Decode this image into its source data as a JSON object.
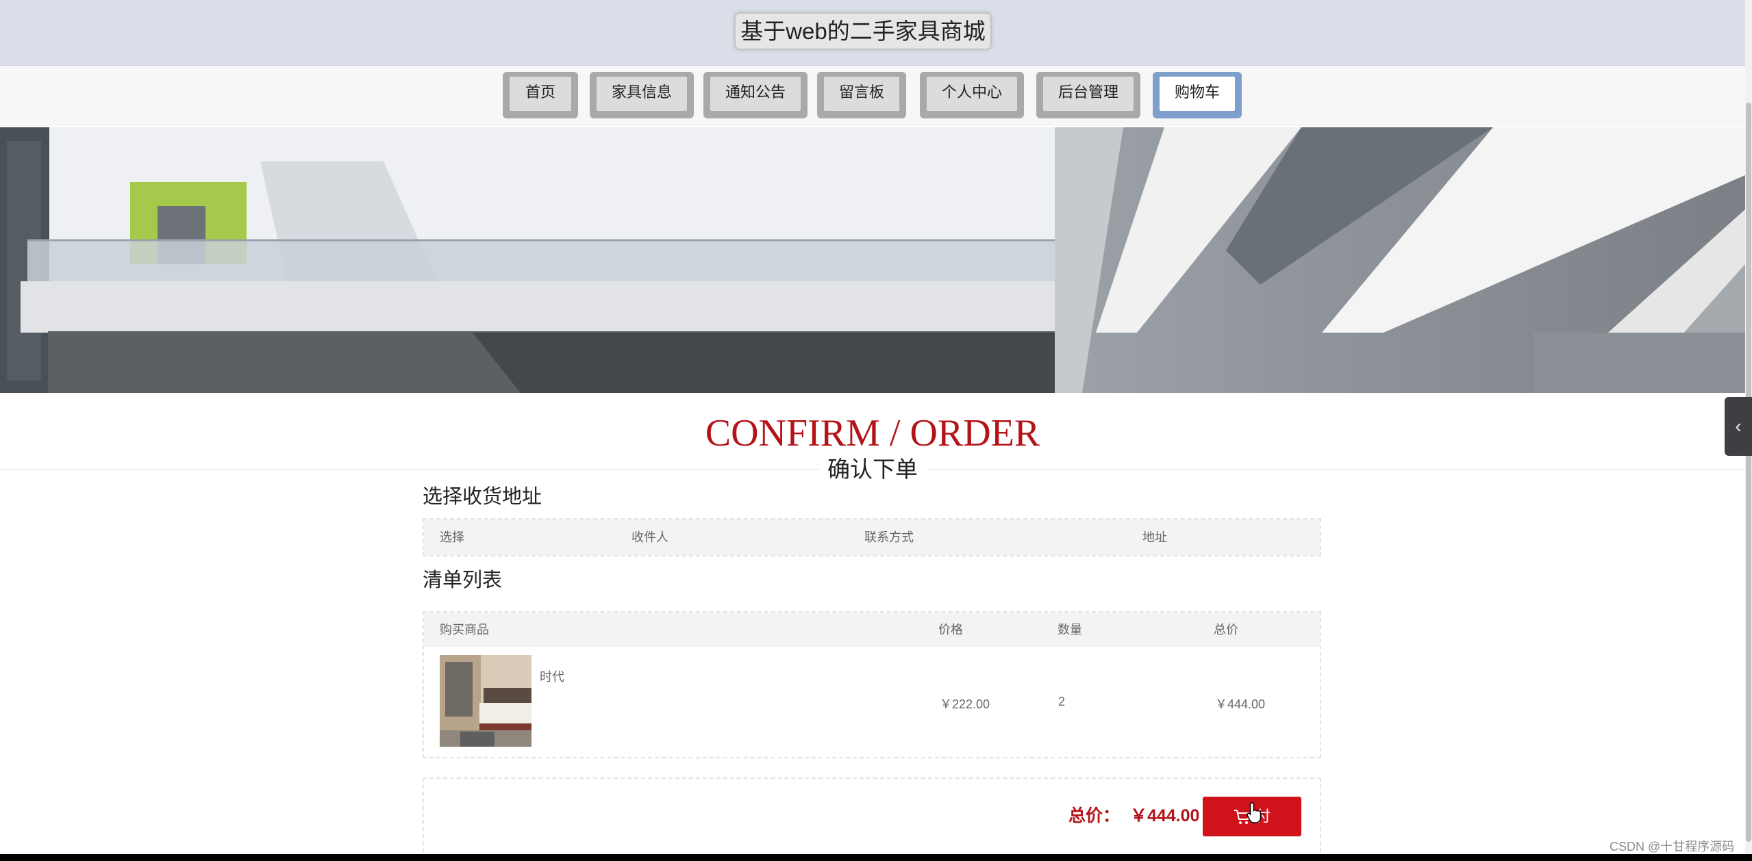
{
  "site": {
    "title": "基于web的二手家具商城"
  },
  "nav": {
    "items": [
      {
        "label": "首页",
        "active": false
      },
      {
        "label": "家具信息",
        "active": false
      },
      {
        "label": "通知公告",
        "active": false
      },
      {
        "label": "留言板",
        "active": false
      },
      {
        "label": "个人中心",
        "active": false
      },
      {
        "label": "后台管理",
        "active": false
      },
      {
        "label": "购物车",
        "active": true
      }
    ]
  },
  "heading": {
    "en": "CONFIRM / ORDER",
    "cn": "确认下单"
  },
  "address": {
    "title": "选择收货地址",
    "columns": [
      "选择",
      "收件人",
      "联系方式",
      "地址"
    ]
  },
  "items": {
    "title": "清单列表",
    "columns": [
      "购买商品",
      "价格",
      "数量",
      "总价"
    ],
    "rows": [
      {
        "name": "时代",
        "price": "￥222.00",
        "quantity": "2",
        "subtotal": "￥444.00"
      }
    ]
  },
  "summary": {
    "total_label": "总价：",
    "total_value": "￥444.00",
    "pay_label": "付"
  },
  "watermark": "CSDN @十甘程序源码",
  "colors": {
    "accent_red": "#b3141a",
    "button_red": "#d0121b",
    "active_nav": "#7e9fcb"
  },
  "icons": {
    "side_tab": "chevron-left-icon",
    "pay": "cart-icon",
    "cursor": "hand-cursor-icon"
  }
}
